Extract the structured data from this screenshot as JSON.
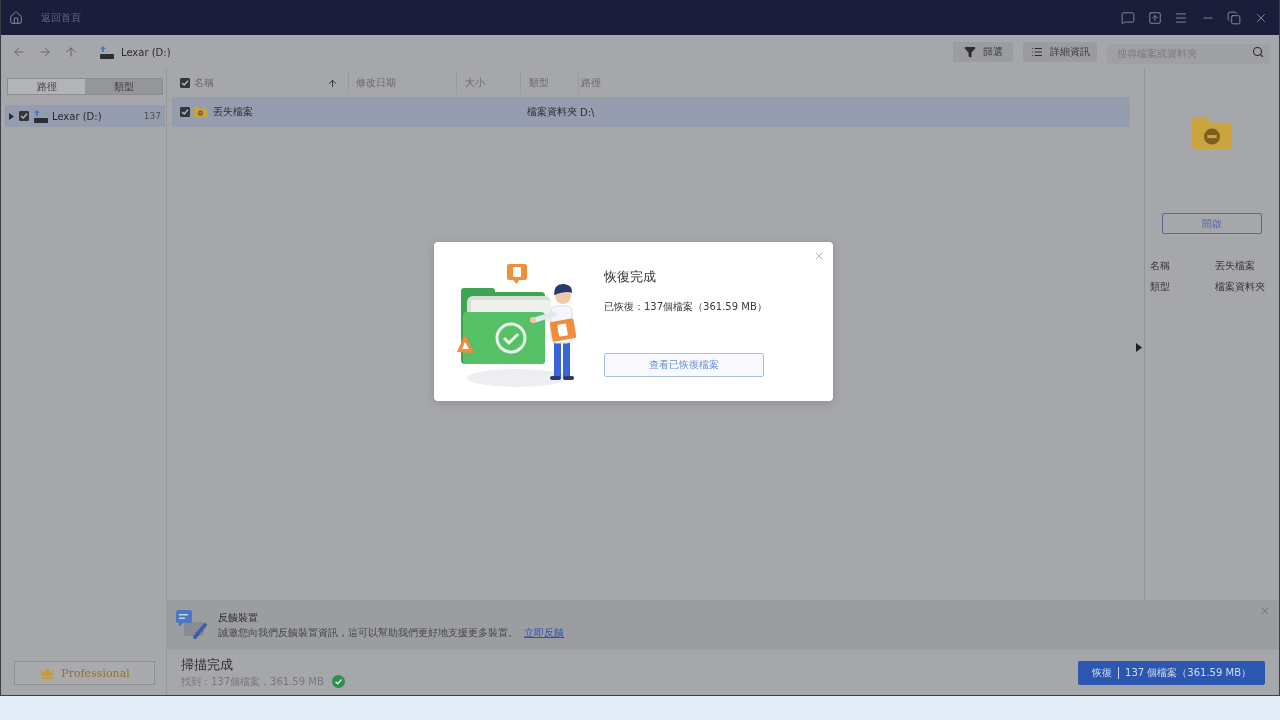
{
  "title_bar": {
    "title": "返回首頁"
  },
  "toolbar": {
    "location": "Lexar (D:)",
    "buttons": [
      {
        "kind": "filter",
        "label": "篩選"
      },
      {
        "kind": "details",
        "label": "詳細資訊"
      }
    ],
    "search": {
      "placeholder": "搜尋檔案或資料夾"
    }
  },
  "sidebar": {
    "tabs": [
      {
        "label": "路徑",
        "selected": true
      },
      {
        "label": "類型",
        "selected": false
      }
    ],
    "tree": [
      {
        "label": "Lexar (D:)",
        "count": "137",
        "expanded": false,
        "checked": true,
        "selected": true
      }
    ],
    "edition_button": "Professional"
  },
  "table": {
    "all_checked": true,
    "columns": [
      {
        "label": "名稱",
        "sorted": true
      },
      {
        "label": "修改日期",
        "sorted": false
      },
      {
        "label": "大小",
        "sorted": false
      },
      {
        "label": "類型",
        "sorted": false
      },
      {
        "label": "路徑",
        "sorted": false
      }
    ],
    "rows": [
      {
        "name": "丟失檔案",
        "type": "檔案資料夾",
        "path": "D:\\",
        "checked": true,
        "selected": true
      }
    ]
  },
  "details_panel": {
    "open_button": "開啟",
    "properties": [
      {
        "label": "名稱",
        "value": "丟失檔案"
      },
      {
        "label": "類型",
        "value": "檔案資料夾"
      }
    ]
  },
  "feedback_banner": {
    "title": "反饋裝置",
    "message": "誠邀您向我們反饋裝置資訊，這可以幫助我們更好地支援更多裝置。",
    "link": "立即反饋"
  },
  "status_bar": {
    "title": "掃描完成",
    "summary": "找到：137個檔案，361.59 MB",
    "recover_button": {
      "label": "恢復",
      "detail": "137 個檔案（361.59 MB）"
    }
  },
  "dialog": {
    "title": "恢復完成",
    "message": "已恢復：137個檔案（361.59 MB）",
    "button": "查看已恢復檔案"
  }
}
